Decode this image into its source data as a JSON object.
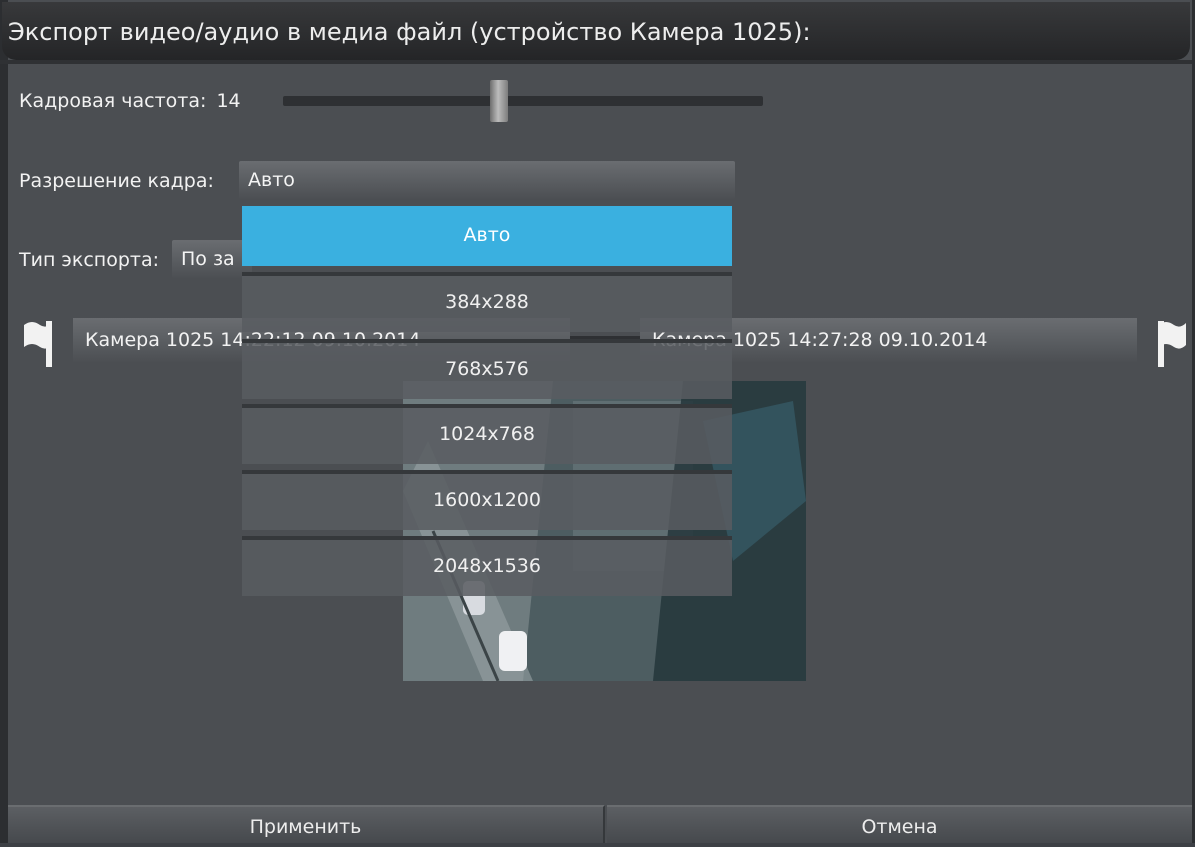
{
  "window": {
    "title": "Экспорт видео/аудио в медиа файл (устройство Камера 1025):"
  },
  "framerate": {
    "label": "Кадровая частота:",
    "value": "14",
    "level": 0.45
  },
  "resolution": {
    "label": "Разрешение кадра:",
    "selected": "Авто",
    "options": [
      "Авто",
      "384x288",
      "768x576",
      "1024x768",
      "1600x1200",
      "2048x1536"
    ]
  },
  "export_type": {
    "label": "Тип экспорта:",
    "value": "По за"
  },
  "range": {
    "start": "Камера 1025 14:22:12  09.10.2014",
    "end": "Камера 1025 14:27:28  09.10.2014"
  },
  "buttons": {
    "apply": "Применить",
    "cancel": "Отмена"
  },
  "colors": {
    "accent": "#3ab0e0",
    "background": "#4b4e52"
  },
  "icons": {
    "start_flag": "flag-icon",
    "end_flag": "flag-icon"
  }
}
